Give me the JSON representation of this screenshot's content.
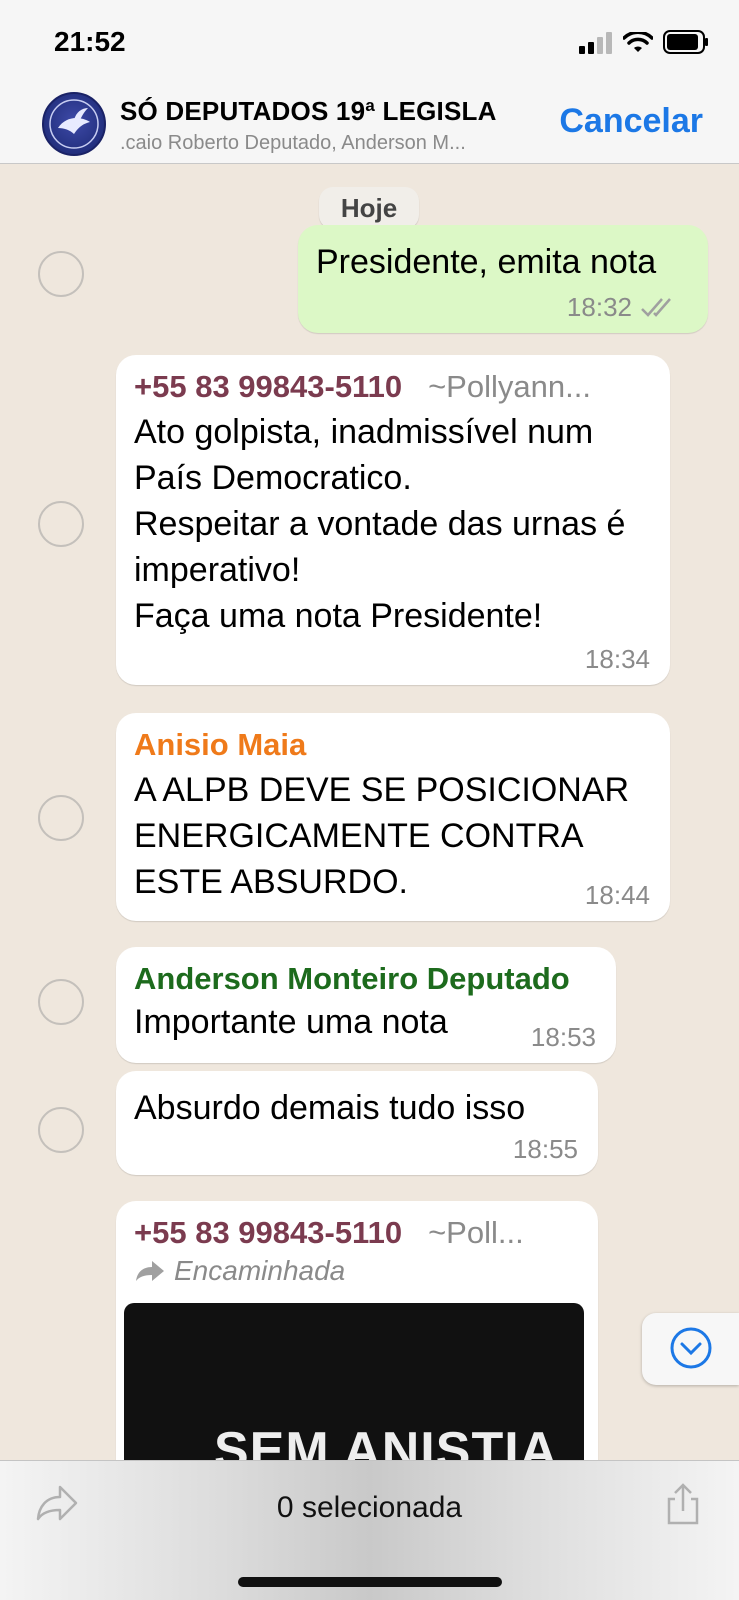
{
  "status_bar": {
    "time": "21:52"
  },
  "header": {
    "title": "SÓ DEPUTADOS 19ª LEGISLA",
    "subtitle": ".caio Roberto Deputado, Anderson M...",
    "cancel_label": "Cancelar"
  },
  "chat": {
    "date_separator": "Hoje",
    "messages": [
      {
        "direction": "outgoing",
        "text": "Presidente, emita nota",
        "time": "18:32"
      },
      {
        "direction": "incoming",
        "sender": "+55 83 99843-5110",
        "alias": "~Pollyann...",
        "lines": [
          "Ato golpista, inadmissível num",
          "País Democratico.",
          "Respeitar a vontade das urnas é",
          "imperativo!",
          "Faça uma nota Presidente!"
        ],
        "time": "18:34"
      },
      {
        "direction": "incoming",
        "sender": "Anisio Maia",
        "lines": [
          "A ALPB DEVE SE POSICIONAR",
          "ENERGICAMENTE CONTRA",
          "ESTE ABSURDO."
        ],
        "time": "18:44"
      },
      {
        "direction": "incoming",
        "sender": "Anderson Monteiro Deputado",
        "text": "Importante uma nota",
        "time": "18:53"
      },
      {
        "direction": "incoming",
        "text": "Absurdo demais tudo isso",
        "time": "18:55"
      },
      {
        "direction": "incoming",
        "sender": "+55 83 99843-5110",
        "alias": "~Poll...",
        "forwarded_label": "Encaminhada",
        "media_caption": "SEM ANISTIA"
      }
    ]
  },
  "bottom_bar": {
    "selected_label": "0 selecionada"
  },
  "colors": {
    "accent": "#1c78e6",
    "outgoing_bubble": "#dcf8c6",
    "sender_phone": "#7b3b4f",
    "sender_anisio": "#ef7a1a",
    "sender_anderson": "#1d6b1d"
  },
  "icons": [
    "signal-icon",
    "wifi-icon",
    "battery-icon",
    "double-check-icon",
    "forward-arrow-icon",
    "chevron-down-icon",
    "share-icon"
  ]
}
